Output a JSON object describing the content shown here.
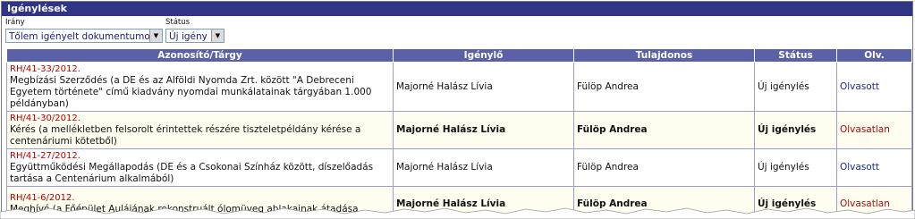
{
  "panel": {
    "title": "Igénylések"
  },
  "filters": {
    "direction": {
      "label": "Irány",
      "value": "Tőlem igényelt dokumentumok"
    },
    "status": {
      "label": "Státus",
      "value": "Új igény"
    }
  },
  "table": {
    "headers": [
      "Azonosító/Tárgy",
      "Igénylő",
      "Tulajdonos",
      "Státus",
      "Olv."
    ],
    "rows": [
      {
        "code": "RH/41-33/2012.",
        "subject": "Megbízási Szerződés (a DE és az Alföldi Nyomda Zrt. között \"A Debreceni Egyetem története\" című kiadvány nyomdai munkálatainak tárgyában 1.000 példányban)",
        "requester": "Majorné Halász Lívia",
        "owner": "Fülöp Andrea",
        "status": "Új igénylés",
        "read": "Olvasott",
        "unread": false
      },
      {
        "code": "RH/41-30/2012.",
        "subject": "Kérés (a mellékletben felsorolt érintettek részére tiszteletpéldány kérése a centenáriumi kötetből)",
        "requester": "Majorné Halász Lívia",
        "owner": "Fülöp Andrea",
        "status": "Új igénylés",
        "read": "Olvasatlan",
        "unread": true
      },
      {
        "code": "RH/41-27/2012.",
        "subject": "Együttműködési Megállapodás (DE és a Csokonai Színház között, díszelőadás tartása a Centenárium alkalmából)",
        "requester": "Majorné Halász Lívia",
        "owner": "Fülöp Andrea",
        "status": "Új igénylés",
        "read": "Olvasott",
        "unread": false
      },
      {
        "code": "RH/41-6/2012.",
        "subject": "Meghívó (a Főépület Aulájának rekonstruált ólomüveg ablakainak átadása",
        "requester": "Majorné Halász Lívia",
        "owner": "Fülöp Andrea",
        "status": "Új igénylés",
        "read": "Olvasatlan",
        "unread": true
      }
    ]
  }
}
